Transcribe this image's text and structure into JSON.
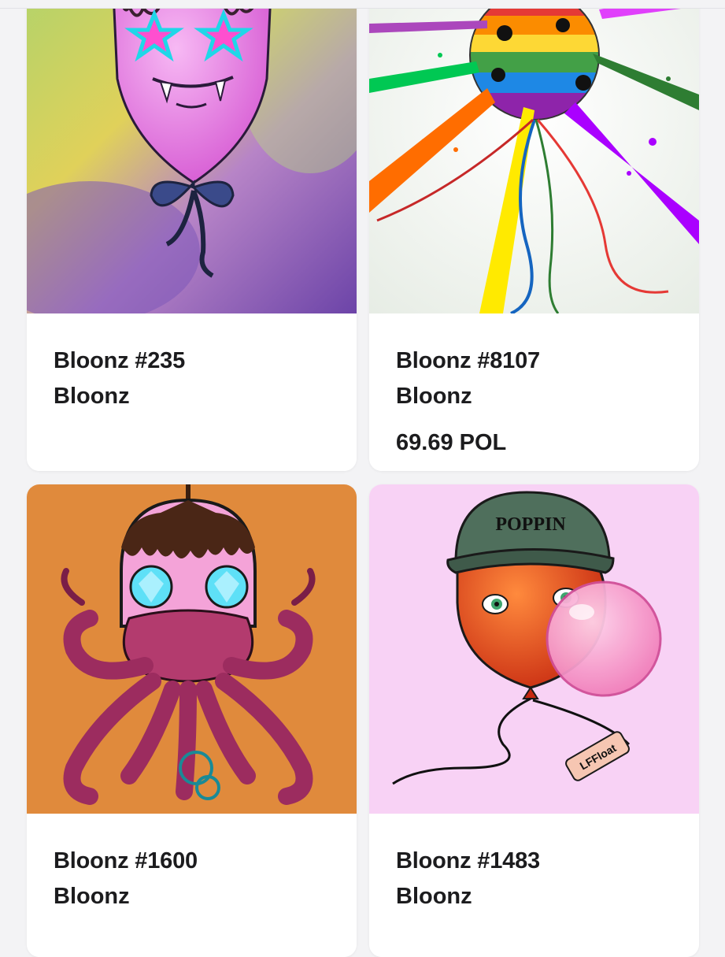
{
  "cards": [
    {
      "name": "Bloonz #235",
      "collection": "Bloonz",
      "price": "",
      "more_icon": "ellipsis-icon"
    },
    {
      "name": "Bloonz #8107",
      "collection": "Bloonz",
      "price": "69.69 POL",
      "more_icon": "ellipsis-icon"
    },
    {
      "name": "Bloonz #1600",
      "collection": "Bloonz",
      "price": ""
    },
    {
      "name": "Bloonz #1483",
      "collection": "Bloonz",
      "price": ""
    }
  ],
  "artwork_text": {
    "cap_text": "POPPIN",
    "tag_text": "LFFloat"
  },
  "colors": {
    "card_bg": "#ffffff",
    "page_bg": "#f3f3f5",
    "text": "#1c1c1e",
    "orange_bg": "#e08a3c",
    "pink_bg": "#f8d2f5"
  }
}
